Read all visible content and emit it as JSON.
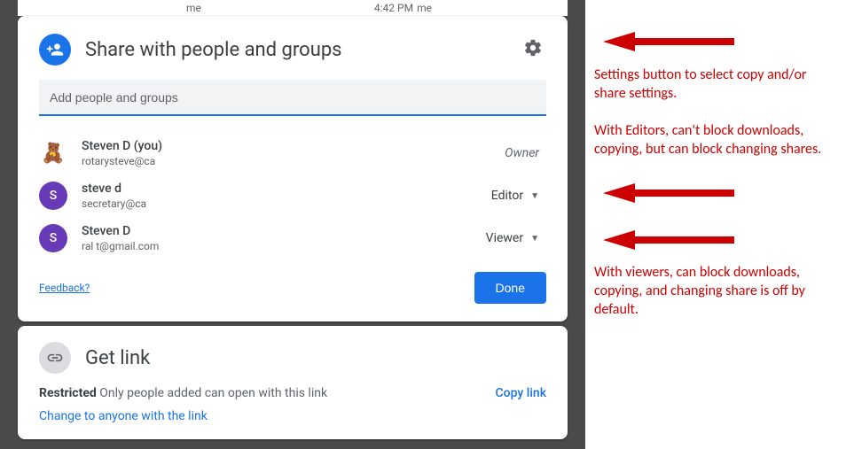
{
  "backgroundBar": {
    "me": "me",
    "time": "4:42 PM",
    "me2": "me"
  },
  "share": {
    "title": "Share with people and groups",
    "placeholder": "Add people and groups",
    "people": [
      {
        "name": "Steven D (you)",
        "email": "rotarysteve@ca",
        "role": "Owner",
        "avatarLetter": "",
        "isOwner": true
      },
      {
        "name": "steve d",
        "email": "secretary@ca",
        "role": "Editor",
        "avatarLetter": "S",
        "isOwner": false
      },
      {
        "name": "Steven D",
        "email": "ral          t@gmail.com",
        "role": "Viewer",
        "avatarLetter": "S",
        "isOwner": false
      }
    ],
    "feedback": "Feedback?",
    "done": "Done"
  },
  "getLink": {
    "title": "Get link",
    "restrictedLabel": "Restricted",
    "restrictedText": " Only people added can open with this link",
    "changeLink": "Change to anyone with the link",
    "copyLink": "Copy link"
  },
  "annotations": {
    "a1": "Settings button to select copy and/or share settings.",
    "a2": "With Editors, can't block downloads, copying, but can block changing shares.",
    "a3": "With viewers, can block downloads, copying, and changing share is off by default."
  }
}
